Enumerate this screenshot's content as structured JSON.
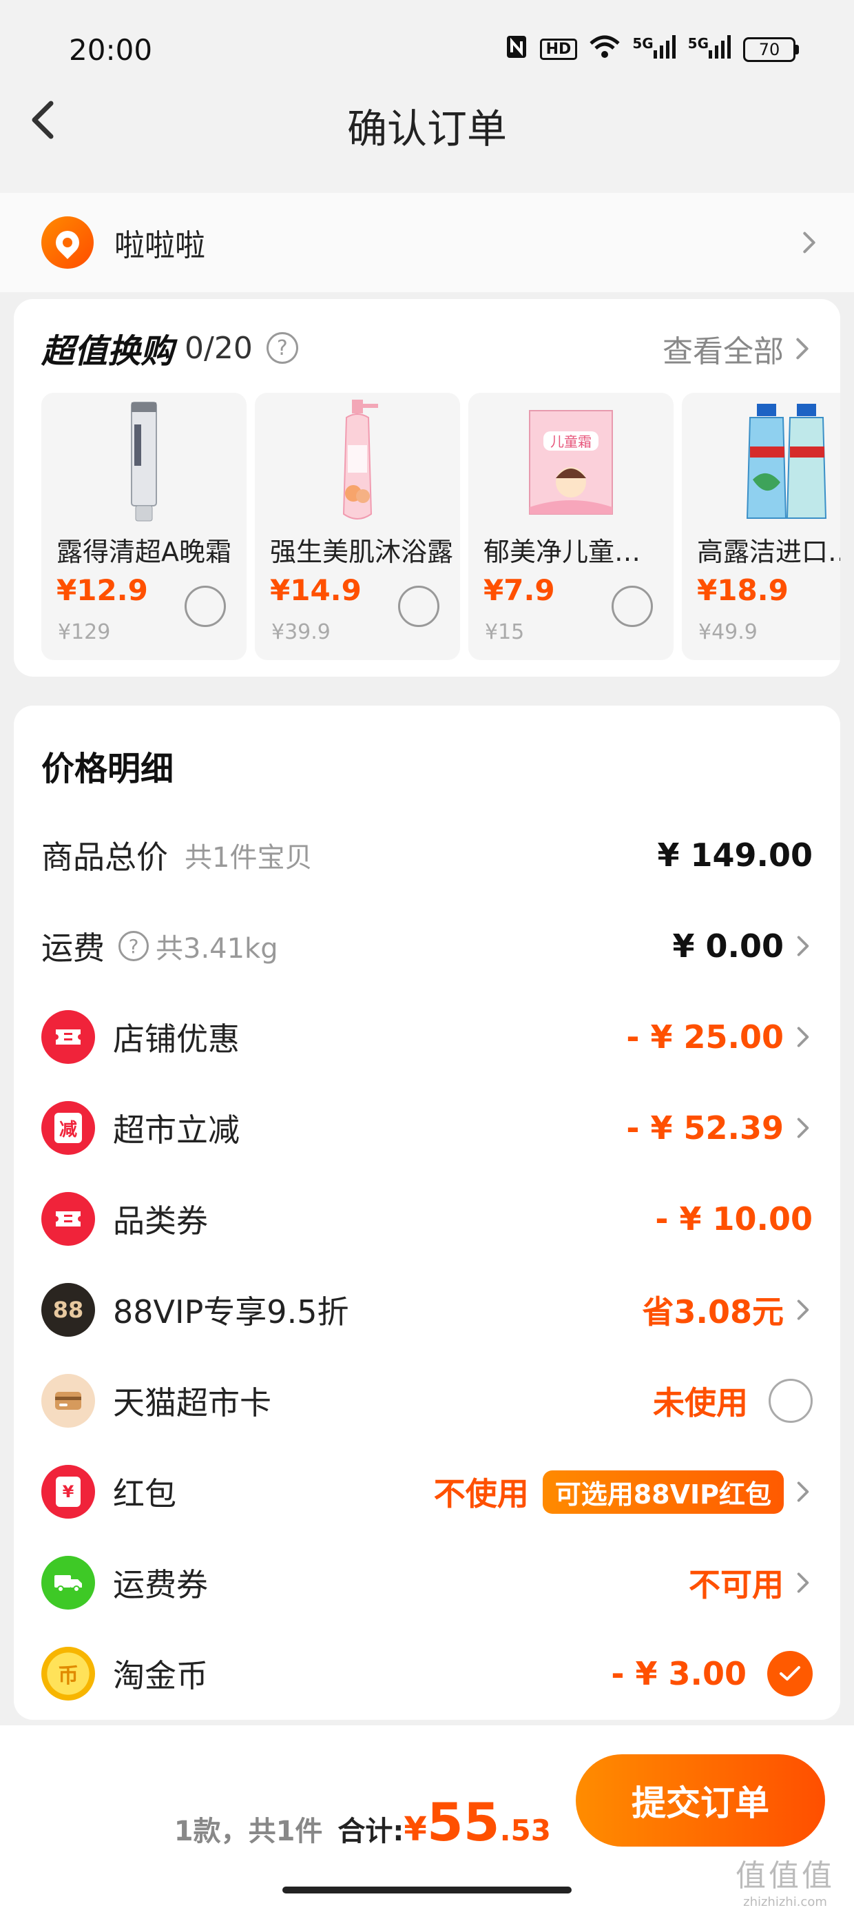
{
  "status": {
    "time": "20:00",
    "battery": "70",
    "icons": [
      "nfc-icon",
      "hd-icon",
      "wifi-icon",
      "signal-5g-icon",
      "signal-5g-icon"
    ],
    "hd_label": "HD",
    "net1": "5G",
    "net2": "5G"
  },
  "nav": {
    "title": "确认订单"
  },
  "address": {
    "name": "啦啦啦"
  },
  "exchange": {
    "title": "超值换购",
    "count": "0/20",
    "view_all": "查看全部",
    "products": [
      {
        "name": "露得清超A晚霜",
        "price": "¥12.9",
        "orig": "¥129"
      },
      {
        "name": "强生美肌沐浴露",
        "price": "¥14.9",
        "orig": "¥39.9"
      },
      {
        "name": "郁美净儿童霜盒装",
        "price": "¥7.9",
        "orig": "¥15"
      },
      {
        "name": "高露洁进口漱口水",
        "price": "¥18.9",
        "orig": "¥49.9"
      }
    ]
  },
  "price_detail": {
    "title": "价格明细",
    "total_label": "商品总价",
    "total_sub": "共1件宝贝",
    "total_value": "¥ 149.00",
    "freight_label": "运费",
    "freight_sub": "共3.41kg",
    "freight_value": "¥ 0.00",
    "shop_label": "店铺优惠",
    "shop_value": "- ¥ 25.00",
    "market_label": "超市立减",
    "market_icon_text": "减",
    "market_value": "- ¥ 52.39",
    "category_label": "品类券",
    "category_value": "- ¥ 10.00",
    "vip_label": "88VIP专享9.5折",
    "vip_icon_text": "88",
    "vip_value": "省3.08元",
    "card_label": "天猫超市卡",
    "card_value": "未使用",
    "hongbao_label": "红包",
    "hongbao_icon_text": "¥",
    "hongbao_value": "不使用",
    "hongbao_tag": "可选用88VIP红包",
    "freight_coupon_label": "运费券",
    "freight_coupon_value": "不可用",
    "coin_label": "淘金币",
    "coin_icon_text": "币",
    "coin_value": "- ¥ 3.00"
  },
  "footer": {
    "count": "1款，共1件",
    "sum_label": "合计:",
    "yen": "¥",
    "amount_int": "55",
    "amount_dec": ".53",
    "submit": "提交订单"
  },
  "watermark": {
    "main": "值值值",
    "sub": "zhizhizhi.com"
  },
  "colors": {
    "accent": "#ff5000",
    "bg": "#f0f0f0"
  }
}
